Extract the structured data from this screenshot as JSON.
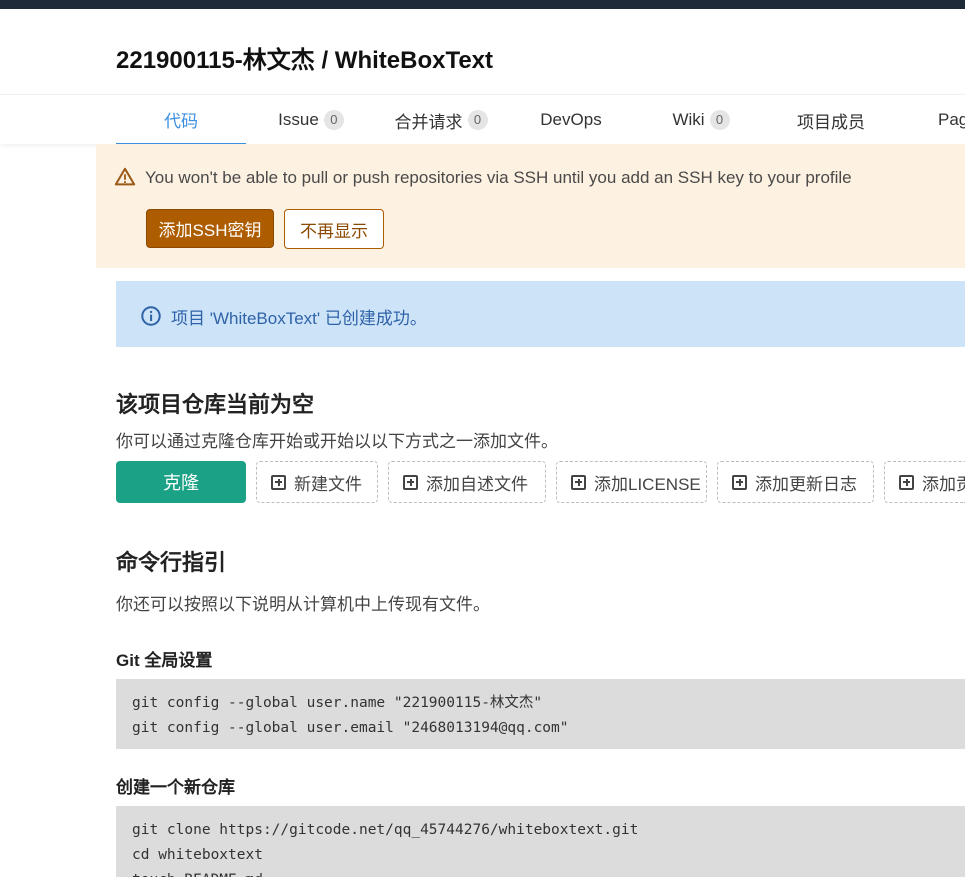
{
  "project": {
    "title": "221900115-林文杰 / WhiteBoxText"
  },
  "tabs": [
    {
      "label": "代码",
      "badge": null,
      "active": true
    },
    {
      "label": "Issue",
      "badge": "0"
    },
    {
      "label": "合并请求",
      "badge": "0"
    },
    {
      "label": "DevOps",
      "badge": null
    },
    {
      "label": "Wiki",
      "badge": "0"
    },
    {
      "label": "项目成员",
      "badge": null
    },
    {
      "label": "Pag",
      "badge": null
    }
  ],
  "ssh_warning": {
    "icon": "warning-triangle-icon",
    "text": "You won't be able to pull or push repositories via SSH until you add an SSH key to your profile",
    "add_button": "添加SSH密钥",
    "dismiss_button": "不再显示"
  },
  "info_alert": {
    "icon": "info-circle-icon",
    "text": "项目 'WhiteBoxText' 已创建成功。"
  },
  "empty_repo": {
    "heading": "该项目仓库当前为空",
    "description": "你可以通过克隆仓库开始或开始以以下方式之一添加文件。",
    "clone_button": "克隆",
    "actions": [
      "新建文件",
      "添加自述文件",
      "添加LICENSE",
      "添加更新日志",
      "添加贡"
    ]
  },
  "cli": {
    "heading": "命令行指引",
    "description": "你还可以按照以下说明从计算机中上传现有文件。",
    "git_setup": {
      "title": "Git 全局设置",
      "lines": [
        "git config --global user.name \"221900115-林文杰\"",
        "git config --global user.email \"2468013194@qq.com\""
      ]
    },
    "new_repo": {
      "title": "创建一个新仓库",
      "lines": [
        "git clone https://gitcode.net/qq_45744276/whiteboxtext.git",
        "cd whiteboxtext",
        "touch README.md"
      ]
    }
  },
  "colors": {
    "accent": "#3d8fe0",
    "warning_bg": "#fdf1e1",
    "warning_button": "#ad5c00",
    "info_bg": "#cde3f8",
    "clone_button": "#1aa186"
  }
}
